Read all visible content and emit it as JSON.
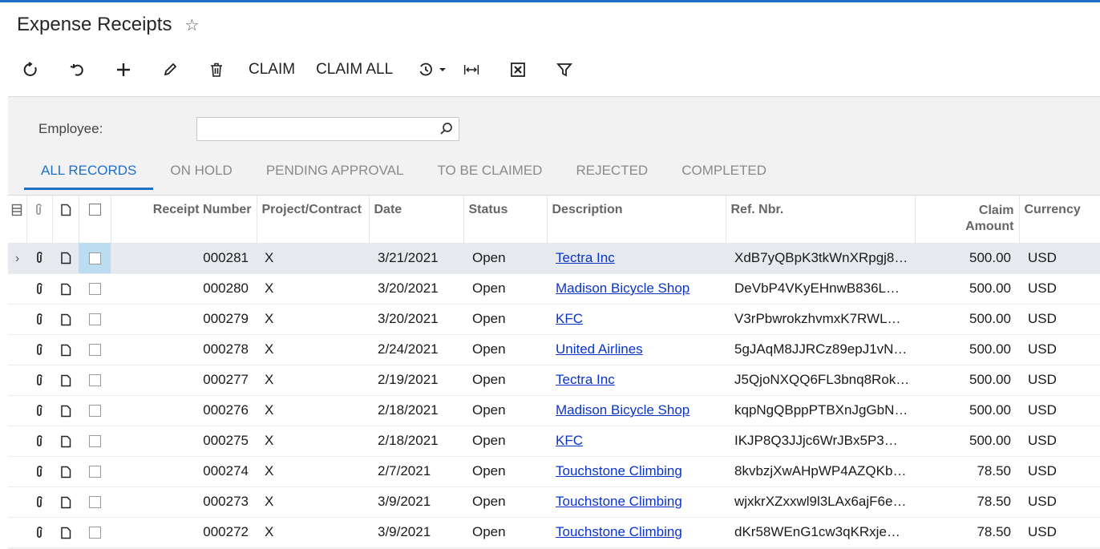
{
  "page": {
    "title": "Expense Receipts"
  },
  "toolbar": {
    "claim_label": "CLAIM",
    "claim_all_label": "CLAIM ALL",
    "icons": [
      "refresh-icon",
      "undo-icon",
      "add-icon",
      "edit-icon",
      "delete-icon",
      "history-icon",
      "fit-columns-icon",
      "export-excel-icon",
      "filter-icon"
    ]
  },
  "filter": {
    "employee_label": "Employee:",
    "employee_value": "",
    "employee_placeholder": ""
  },
  "tabs": [
    "ALL RECORDS",
    "ON HOLD",
    "PENDING APPROVAL",
    "TO BE CLAIMED",
    "REJECTED",
    "COMPLETED"
  ],
  "grid": {
    "columns": {
      "receipt_number": "Receipt Number",
      "project_contract": "Project/Contract",
      "date": "Date",
      "status": "Status",
      "description": "Description",
      "ref_nbr": "Ref. Nbr.",
      "claim_amount": "Claim Amount",
      "currency": "Currency"
    },
    "rows": [
      {
        "receipt": "000281",
        "project": "X",
        "date": "3/21/2021",
        "status": "Open",
        "description": "Tectra Inc",
        "ref": "XdB7yQBpK3tkWnXRpgj8…",
        "amount": "500.00",
        "currency": "USD"
      },
      {
        "receipt": "000280",
        "project": "X",
        "date": "3/20/2021",
        "status": "Open",
        "description": "Madison Bicycle Shop",
        "ref": "DeVbP4VKyEHnwB836L…",
        "amount": "500.00",
        "currency": "USD"
      },
      {
        "receipt": "000279",
        "project": "X",
        "date": "3/20/2021",
        "status": "Open",
        "description": "KFC",
        "ref": "V3rPbwrokzhvmxK7RWL…",
        "amount": "500.00",
        "currency": "USD"
      },
      {
        "receipt": "000278",
        "project": "X",
        "date": "2/24/2021",
        "status": "Open",
        "description": "United Airlines",
        "ref": "5gJAqM8JJRCz89epJ1vN…",
        "amount": "500.00",
        "currency": "USD"
      },
      {
        "receipt": "000277",
        "project": "X",
        "date": "2/19/2021",
        "status": "Open",
        "description": "Tectra Inc",
        "ref": "J5QjoNXQQ6FL3bnq8Rok…",
        "amount": "500.00",
        "currency": "USD"
      },
      {
        "receipt": "000276",
        "project": "X",
        "date": "2/18/2021",
        "status": "Open",
        "description": "Madison Bicycle Shop",
        "ref": "kqpNgQBppPTBXnJgGbN…",
        "amount": "500.00",
        "currency": "USD"
      },
      {
        "receipt": "000275",
        "project": "X",
        "date": "2/18/2021",
        "status": "Open",
        "description": "KFC",
        "ref": "IKJP8Q3JJjc6WrJBx5P3…",
        "amount": "500.00",
        "currency": "USD"
      },
      {
        "receipt": "000274",
        "project": "X",
        "date": "2/7/2021",
        "status": "Open",
        "description": "Touchstone Climbing",
        "ref": "8kvbzjXwAHpWP4AZQKb…",
        "amount": "78.50",
        "currency": "USD"
      },
      {
        "receipt": "000273",
        "project": "X",
        "date": "3/9/2021",
        "status": "Open",
        "description": "Touchstone Climbing",
        "ref": "wjxkrXZxxwl9l3LAx6ajF6e…",
        "amount": "78.50",
        "currency": "USD"
      },
      {
        "receipt": "000272",
        "project": "X",
        "date": "3/9/2021",
        "status": "Open",
        "description": "Touchstone Climbing",
        "ref": "dKr58WEnG1cw3qKRxje…",
        "amount": "78.50",
        "currency": "USD"
      }
    ]
  },
  "colors": {
    "accent": "#1f6fc7",
    "link": "#0a34c8",
    "selected_row": "#e6e9ee",
    "selected_checkbox_cell": "#bcdcf2"
  }
}
